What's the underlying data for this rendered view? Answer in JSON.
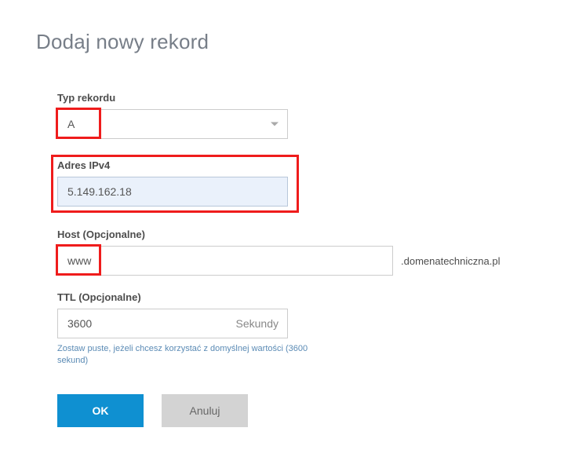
{
  "page_title": "Dodaj nowy rekord",
  "fields": {
    "record_type": {
      "label": "Typ rekordu",
      "value": "A"
    },
    "ipv4": {
      "label": "Adres IPv4",
      "value": "5.149.162.18"
    },
    "host": {
      "label": "Host (Opcjonalne)",
      "value": "www",
      "suffix": ".domenatechniczna.pl"
    },
    "ttl": {
      "label": "TTL (Opcjonalne)",
      "value": "3600",
      "unit": "Sekundy",
      "hint": "Zostaw puste, jeżeli chcesz korzystać z domyślnej wartości (3600 sekund)"
    }
  },
  "buttons": {
    "ok": "OK",
    "cancel": "Anuluj"
  }
}
